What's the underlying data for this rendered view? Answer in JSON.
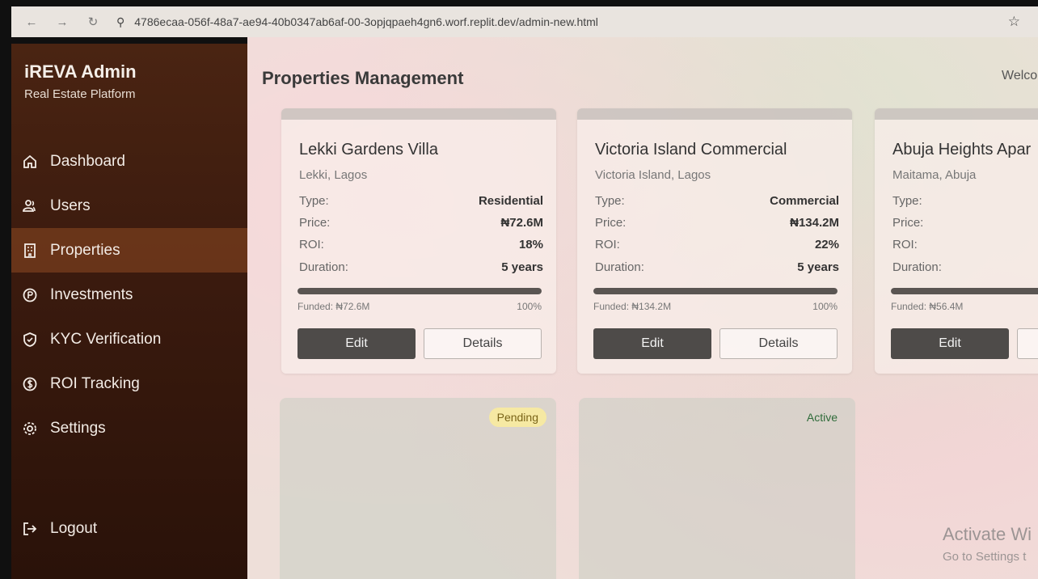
{
  "browser": {
    "url": "4786ecaa-056f-48a7-ae94-40b0347ab6af-00-3opjqpaeh4gn6.worf.replit.dev/admin-new.html"
  },
  "sidebar": {
    "title": "iREVA Admin",
    "subtitle": "Real Estate Platform",
    "items": [
      {
        "label": "Dashboard",
        "icon": "home-icon"
      },
      {
        "label": "Users",
        "icon": "users-icon"
      },
      {
        "label": "Properties",
        "icon": "building-icon",
        "active": true
      },
      {
        "label": "Investments",
        "icon": "coin-icon"
      },
      {
        "label": "KYC Verification",
        "icon": "shield-icon"
      },
      {
        "label": "ROI Tracking",
        "icon": "dollar-icon"
      },
      {
        "label": "Settings",
        "icon": "gear-icon"
      }
    ],
    "logout": "Logout"
  },
  "header": {
    "title": "Properties Management",
    "welcome": "Welco"
  },
  "labels": {
    "type": "Type:",
    "price": "Price:",
    "roi": "ROI:",
    "duration": "Duration:",
    "edit": "Edit",
    "details": "Details"
  },
  "properties": [
    {
      "name": "Lekki Gardens Villa",
      "location": "Lekki, Lagos",
      "type": "Residential",
      "price": "₦72.6M",
      "roi": "18%",
      "duration": "5 years",
      "funded": "Funded: ₦72.6M",
      "percent": "100%",
      "fill": 100
    },
    {
      "name": "Victoria Island Commercial",
      "location": "Victoria Island, Lagos",
      "type": "Commercial",
      "price": "₦134.2M",
      "roi": "22%",
      "duration": "5 years",
      "funded": "Funded: ₦134.2M",
      "percent": "100%",
      "fill": 100
    },
    {
      "name": "Abuja Heights Apar",
      "location": "Maitama, Abuja",
      "type": "",
      "price": "",
      "roi": "",
      "duration": "",
      "funded": "Funded: ₦56.4M",
      "percent": "",
      "fill": 100
    }
  ],
  "status_cards": [
    {
      "status": "Pending"
    },
    {
      "status": "Active"
    }
  ],
  "watermark": {
    "line1": "Activate Wi",
    "line2": "Go to Settings t"
  }
}
